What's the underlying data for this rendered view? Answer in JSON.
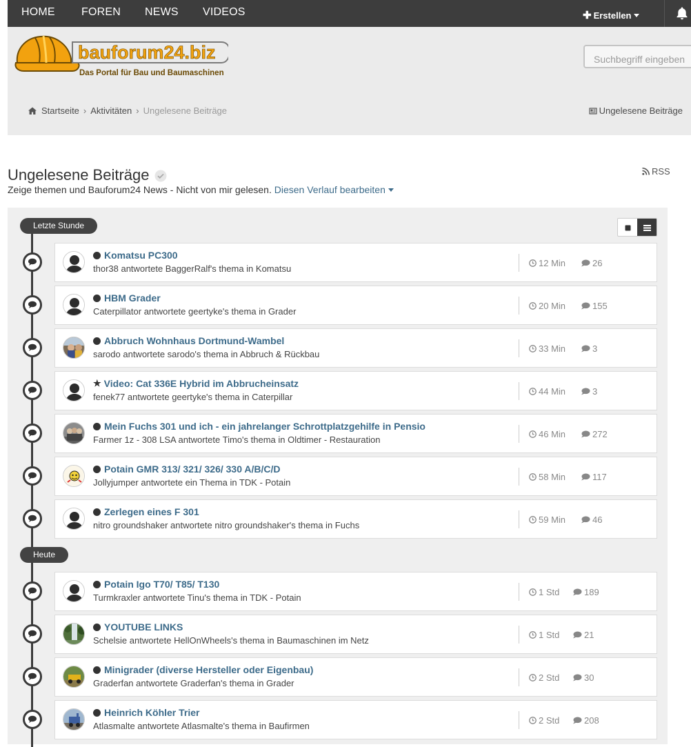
{
  "nav": {
    "items": [
      "HOME",
      "FOREN",
      "NEWS",
      "VIDEOS"
    ],
    "create_label": "Erstellen"
  },
  "logo": {
    "name": "bauforum24.biz",
    "tagline": "Das Portal für Bau und Baumaschinen"
  },
  "search": {
    "placeholder": "Suchbegriff eingeben"
  },
  "breadcrumb": {
    "items": [
      "Startseite",
      "Aktivitäten",
      "Ungelesene Beiträge"
    ],
    "right_link": "Ungelesene Beiträge"
  },
  "page": {
    "title": "Ungelesene Beiträge",
    "rss": "RSS",
    "subtitle": "Zeige themen und Bauforum24 News - Nicht von mir gelesen.",
    "edit_link": "Diesen Verlauf bearbeiten"
  },
  "sections": [
    {
      "label": "Letzte Stunde",
      "items": [
        {
          "title": "Komatsu PC300",
          "marker": "dot",
          "meta": "thor38 antwortete BaggerRalf's thema in Komatsu",
          "time": "12 Min",
          "replies": "26",
          "avatar": "default"
        },
        {
          "title": "HBM Grader",
          "marker": "dot",
          "meta": "Caterpillator antwortete geertyke's thema in Grader",
          "time": "20 Min",
          "replies": "155",
          "avatar": "default"
        },
        {
          "title": "Abbruch Wohnhaus Dortmund-Wambel",
          "marker": "dot",
          "meta": "sarodo antwortete sarodo's thema in Abbruch & Rückbau",
          "time": "33 Min",
          "replies": "3",
          "avatar": "photo-people"
        },
        {
          "title": "Video: Cat 336E Hybrid im Abbrucheinsatz",
          "marker": "star",
          "meta": "fenek77 antwortete geertyke's thema in Caterpillar",
          "time": "44 Min",
          "replies": "3",
          "avatar": "default"
        },
        {
          "title": "Mein Fuchs 301 und ich - ein jahrelanger Schrottplatzgehilfe in Pensio",
          "marker": "dot",
          "meta": "Farmer 1z - 308 LSA antwortete Timo's thema in Oldtimer - Restauration",
          "time": "46 Min",
          "replies": "272",
          "avatar": "photo-group"
        },
        {
          "title": "Potain GMR 313/ 321/ 326/ 330 A/B/C/D",
          "marker": "dot",
          "meta": "Jollyjumper antwortete ein Thema in TDK - Potain",
          "time": "58 Min",
          "replies": "117",
          "avatar": "photo-cartoon"
        },
        {
          "title": "Zerlegen eines F 301",
          "marker": "dot",
          "meta": "nitro groundshaker antwortete nitro groundshaker's thema in Fuchs",
          "time": "59 Min",
          "replies": "46",
          "avatar": "default"
        }
      ]
    },
    {
      "label": "Heute",
      "items": [
        {
          "title": "Potain Igo T70/ T85/ T130",
          "marker": "dot",
          "meta": "Turmkraxler antwortete Tinu's thema in TDK - Potain",
          "time": "1 Std",
          "replies": "189",
          "avatar": "default"
        },
        {
          "title": "YOUTUBE LINKS",
          "marker": "dot",
          "meta": "Schelsie antwortete HellOnWheels's thema in Baumaschinen im Netz",
          "time": "1 Std",
          "replies": "21",
          "avatar": "photo-waterfall"
        },
        {
          "title": "Minigrader (diverse Hersteller oder Eigenbau)",
          "marker": "dot",
          "meta": "Graderfan antwortete Graderfan's thema in Grader",
          "time": "2 Std",
          "replies": "30",
          "avatar": "photo-grader"
        },
        {
          "title": "Heinrich Köhler Trier",
          "marker": "dot",
          "meta": "Atlasmalte antwortete Atlasmalte's thema in Baufirmen",
          "time": "2 Std",
          "replies": "208",
          "avatar": "photo-machine"
        }
      ]
    }
  ],
  "colors": {
    "topbar": "#3d3d3d",
    "header": "#ebebeb",
    "link": "#3d6b8a",
    "logo_orange": "#f2a20f"
  }
}
